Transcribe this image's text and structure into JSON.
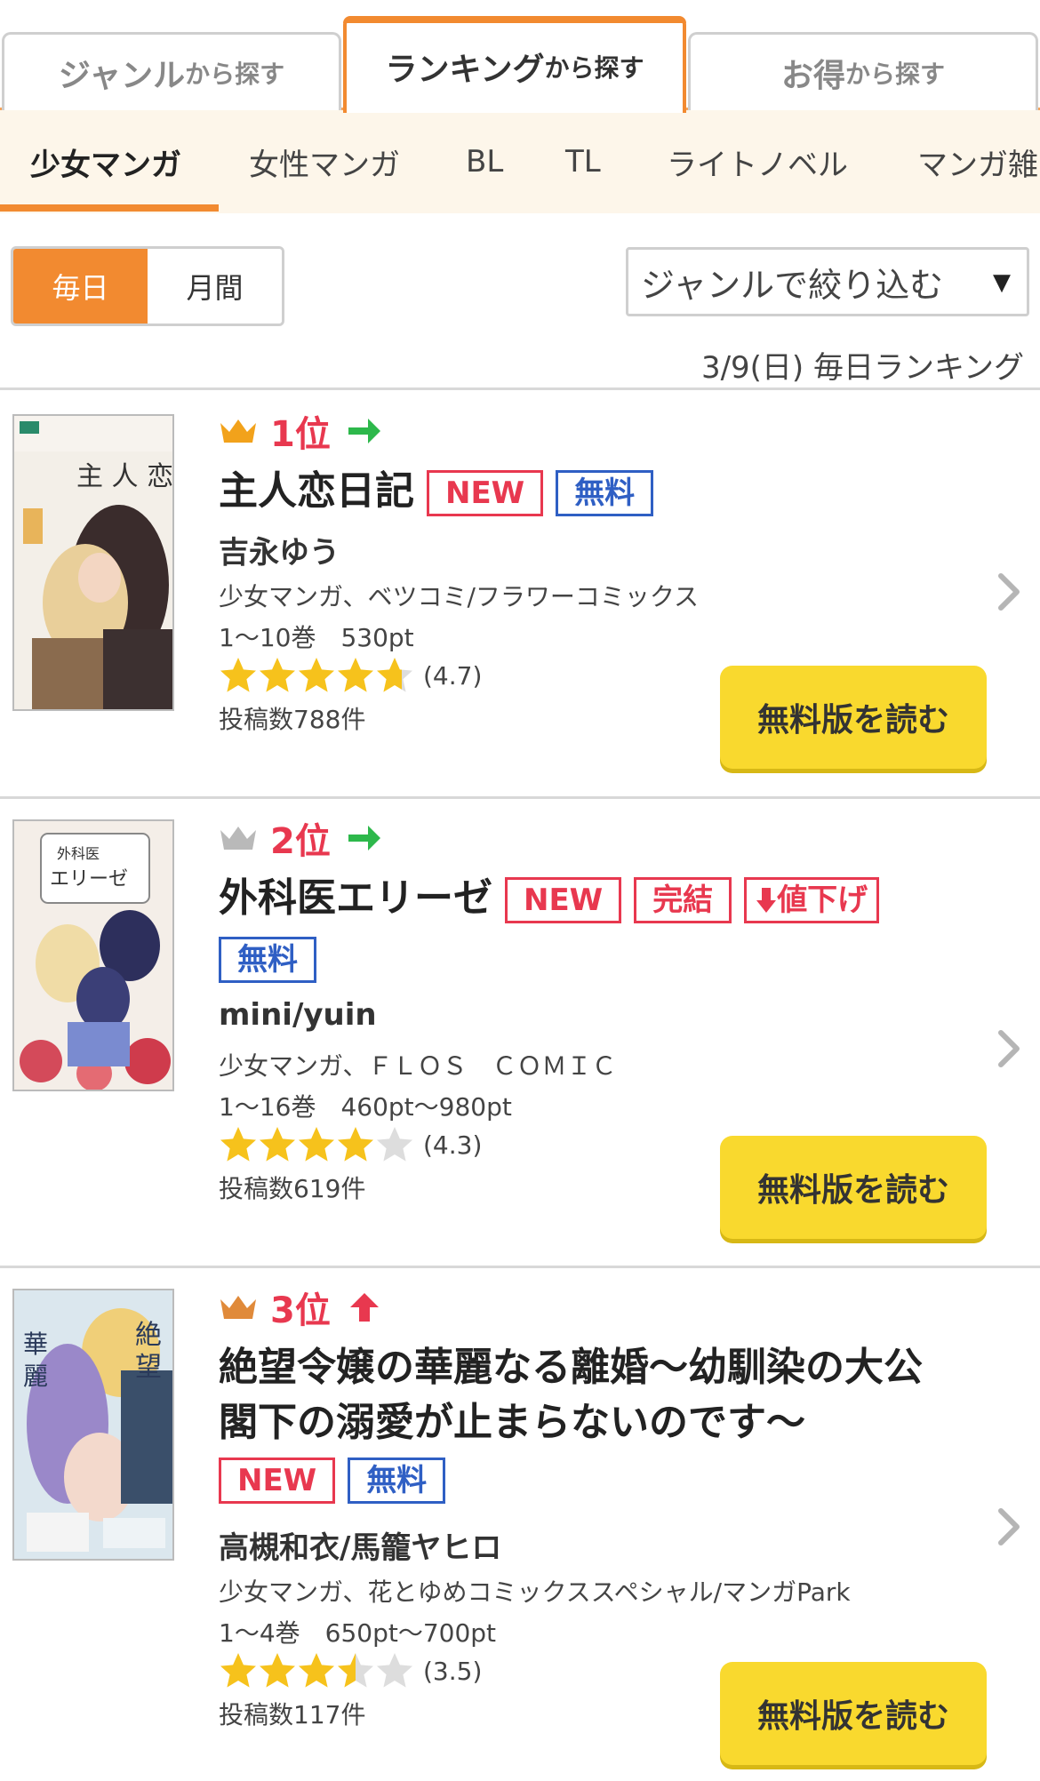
{
  "tabs": {
    "genre": {
      "big": "ジャンル",
      "small": "から探す"
    },
    "ranking": {
      "big": "ランキング",
      "small": "から探す"
    },
    "deal": {
      "big": "お得",
      "small": "から探す"
    }
  },
  "genres": [
    "少女マンガ",
    "女性マンガ",
    "BL",
    "TL",
    "ライトノベル",
    "マンガ雑"
  ],
  "period": {
    "daily": "毎日",
    "monthly": "月間"
  },
  "filter": {
    "label": "ジャンルで絞り込む",
    "caret": "▼"
  },
  "date_line": "3/9(日) 毎日ランキング",
  "colors": {
    "accent": "#f28a30",
    "rank": "#e8384f",
    "free_badge": "#2f5fc4",
    "button": "#f9d92e",
    "gold_crown": "#f2a21b",
    "silver_crown": "#b9b9b9",
    "bronze_crown": "#e08a3a",
    "arrow_green": "#2db84b"
  },
  "items": [
    {
      "rank": "1位",
      "trend": "right-arrow-icon",
      "title": "主人恋日記",
      "badges": {
        "new": "NEW",
        "free": "無料"
      },
      "author": "吉永ゆう",
      "genre_label": "少女マンガ、ベツコミ/フラワーコミックス",
      "volumes": "1〜10巻　530pt",
      "rating_value": 4.7,
      "rating": "(4.7)",
      "reviews": "投稿数788件",
      "button": "無料版を読む"
    },
    {
      "rank": "2位",
      "trend": "right-arrow-icon",
      "title": "外科医エリーゼ",
      "badges": {
        "new": "NEW",
        "done": "完結",
        "down": "値下げ",
        "free": "無料"
      },
      "author": "mini/yuin",
      "genre_label": "少女マンガ、ＦＬＯＳ　ＣＯＭＩＣ",
      "volumes": "1〜16巻　460pt〜980pt",
      "rating_value": 4.3,
      "rating": "(4.3)",
      "reviews": "投稿数619件",
      "button": "無料版を読む"
    },
    {
      "rank": "3位",
      "trend": "up-arrow-icon",
      "title_line1": "絶望令嬢の華麗なる離婚〜幼馴染の大公",
      "title_line2": "閣下の溺愛が止まらないのです〜",
      "badges": {
        "new": "NEW",
        "free": "無料"
      },
      "author": "高槻和衣/馬籠ヤヒロ",
      "genre_label": "少女マンガ、花とゆめコミックススペシャル/マンガPark",
      "volumes": "1〜4巻　650pt〜700pt",
      "rating_value": 3.5,
      "rating": "(3.5)",
      "reviews": "投稿数117件",
      "button": "無料版を読む"
    }
  ]
}
